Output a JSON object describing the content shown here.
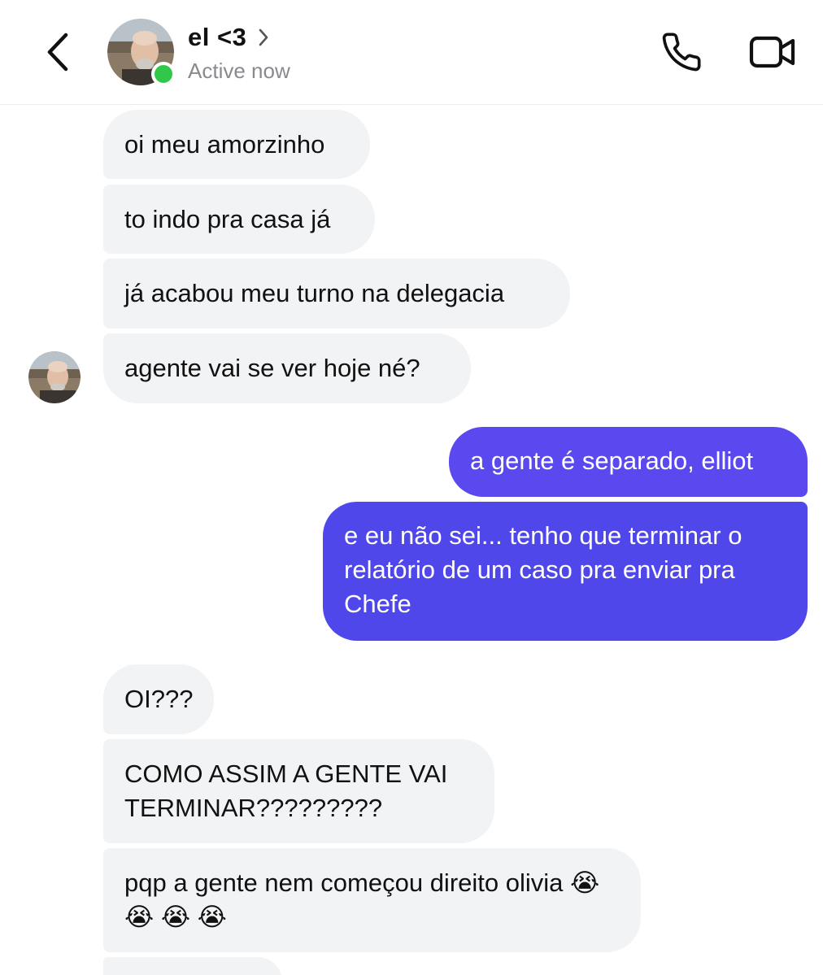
{
  "header": {
    "contact_name": "el <3",
    "status": "Active now",
    "icons": {
      "back": "chevron-left-icon",
      "name_chevron": "chevron-right-icon",
      "call": "phone-icon",
      "video": "video-camera-icon"
    },
    "online_color": "#31c84a"
  },
  "colors": {
    "incoming_bubble": "#f2f3f5",
    "outgoing_bubble": "#5446ee"
  },
  "messages": [
    {
      "direction": "incoming",
      "text": "oi meu amorzinho"
    },
    {
      "direction": "incoming",
      "text": "to indo pra casa já"
    },
    {
      "direction": "incoming",
      "text": "já acabou meu turno na delegacia"
    },
    {
      "direction": "incoming",
      "text": "agente vai se ver hoje né?"
    },
    {
      "direction": "outgoing",
      "text": "a gente é separado, elliot"
    },
    {
      "direction": "outgoing",
      "text": "e eu não sei... tenho que terminar o relatório de um caso pra enviar pra Chefe"
    },
    {
      "direction": "incoming",
      "text": "OI???"
    },
    {
      "direction": "incoming",
      "text": "COMO ASSIM A GENTE VAI TERMINAR?????????"
    },
    {
      "direction": "incoming",
      "text": "pqp a gente nem começou direito olivia 😭 😭 😭 😭"
    }
  ]
}
